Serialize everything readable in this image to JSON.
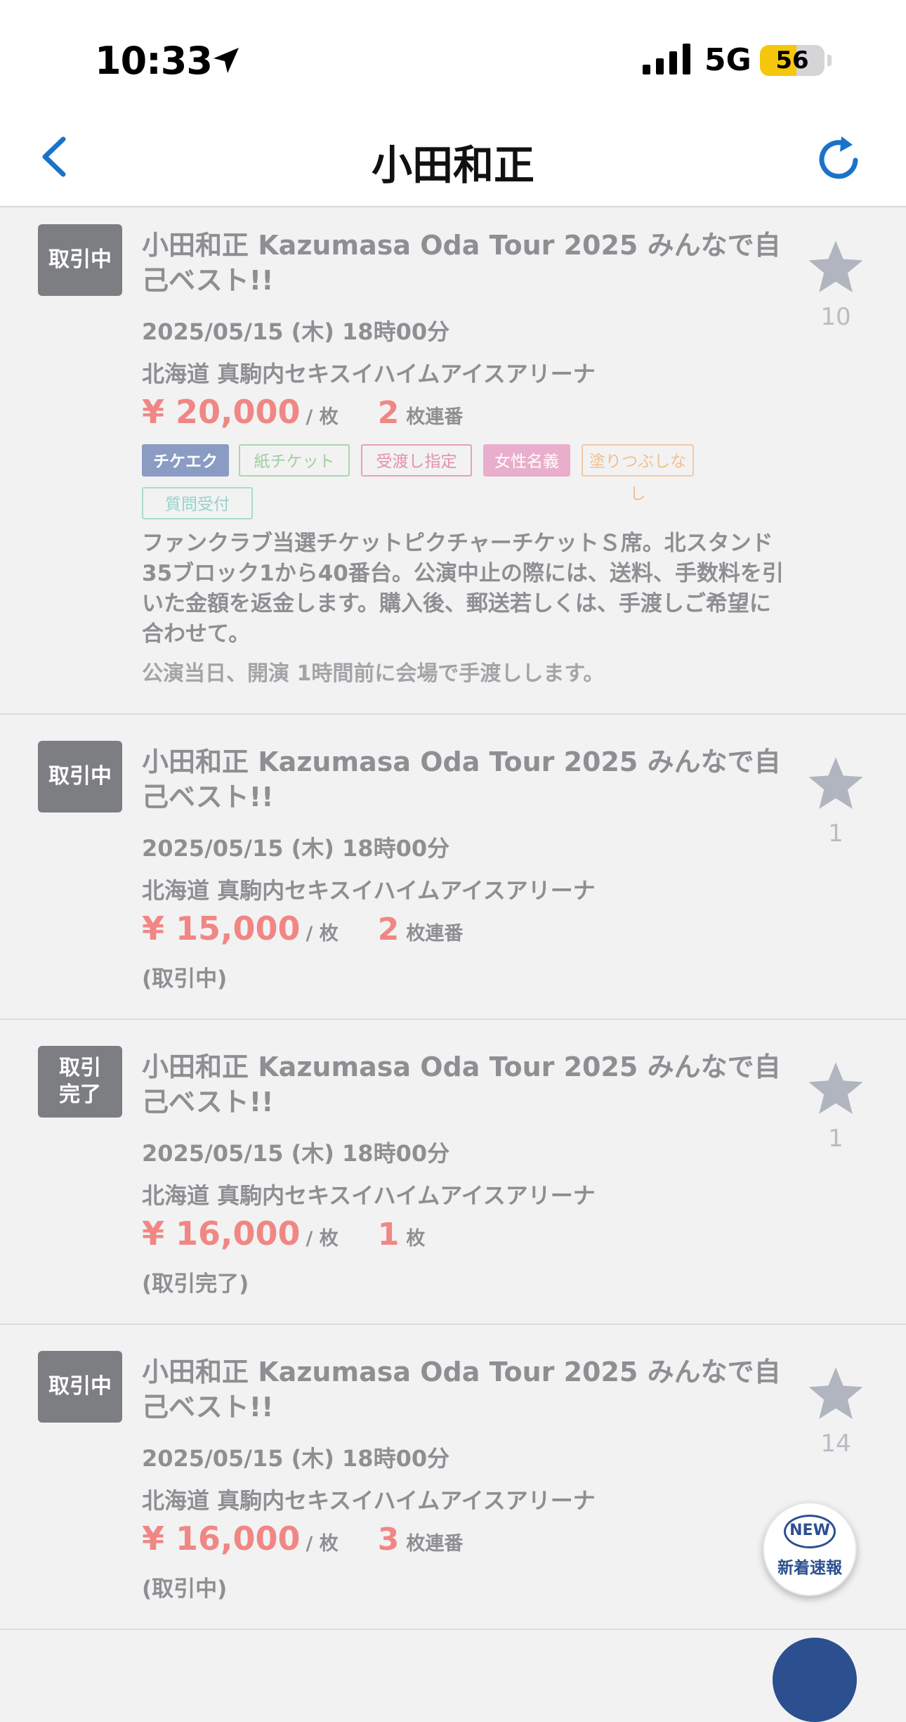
{
  "status_bar": {
    "time": "10:33",
    "network": "5G",
    "battery_level": "56",
    "battery_fraction": 0.56
  },
  "nav": {
    "title": "小田和正",
    "back_icon": "chevron-left-icon",
    "refresh_icon": "refresh-icon"
  },
  "colors": {
    "accent": "#1a73c8",
    "price": "#f08784",
    "badge": "#7c7e82",
    "star": "#b1b5bf"
  },
  "listings": [
    {
      "status": "取引中",
      "title": "小田和正 Kazumasa Oda Tour 2025 みんなで自己ベスト!!",
      "date": "2025/05/15 (木) 18時00分",
      "venue": "北海道 真駒内セキスイハイムアイスアリーナ",
      "price": "¥ 20,000",
      "price_unit": "/ 枚",
      "quantity": "2",
      "quantity_unit": "枚連番",
      "favorites": "10",
      "tags": [
        {
          "label": "チケエク",
          "style": "filled-blue"
        },
        {
          "label": "紙チケット",
          "style": "outline-green"
        },
        {
          "label": "受渡し指定",
          "style": "outline-pink"
        },
        {
          "label": "女性名義",
          "style": "filled-pink"
        },
        {
          "label": "塗りつぶしなし",
          "style": "outline-orange"
        },
        {
          "label": "質問受付",
          "style": "outline-teal"
        }
      ],
      "description": "ファンクラブ当選チケットピクチャーチケットＳ席。北スタンド35ブロック1から40番台。公演中止の際には、送料、手数料を引いた金額を返金します。購入後、郵送若しくは、手渡しご希望に合わせて。",
      "note": "公演当日、開演 1時間前に会場で手渡しします。"
    },
    {
      "status": "取引中",
      "title": "小田和正 Kazumasa Oda Tour 2025 みんなで自己ベスト!!",
      "date": "2025/05/15 (木) 18時00分",
      "venue": "北海道 真駒内セキスイハイムアイスアリーナ",
      "price": "¥ 15,000",
      "price_unit": "/ 枚",
      "quantity": "2",
      "quantity_unit": "枚連番",
      "deal_status": "(取引中)",
      "favorites": "1"
    },
    {
      "status": "取引\n完了",
      "title": "小田和正 Kazumasa Oda Tour 2025 みんなで自己ベスト!!",
      "date": "2025/05/15 (木) 18時00分",
      "venue": "北海道 真駒内セキスイハイムアイスアリーナ",
      "price": "¥ 16,000",
      "price_unit": "/ 枚",
      "quantity": "1",
      "quantity_unit": "枚",
      "deal_status": "(取引完了)",
      "favorites": "1"
    },
    {
      "status": "取引中",
      "title": "小田和正 Kazumasa Oda Tour 2025 みんなで自己ベスト!!",
      "date": "2025/05/15 (木) 18時00分",
      "venue": "北海道 真駒内セキスイハイムアイスアリーナ",
      "price": "¥ 16,000",
      "price_unit": "/ 枚",
      "quantity": "3",
      "quantity_unit": "枚連番",
      "deal_status": "(取引中)",
      "favorites": "14"
    }
  ],
  "new_button": {
    "pill": "NEW",
    "label": "新着速報"
  }
}
